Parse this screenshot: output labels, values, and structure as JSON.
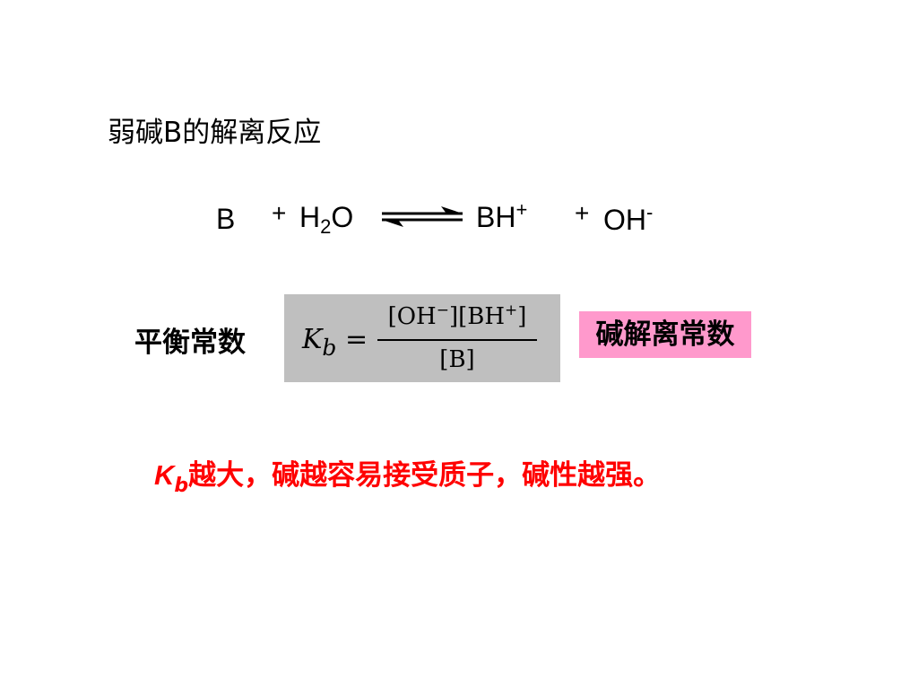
{
  "title": "弱碱B的解离反应",
  "equation": {
    "reactant1": "B",
    "plus1": "+",
    "water_main": "H",
    "water_sub": "2",
    "water_tail": "O",
    "product1_main": "BH",
    "product1_sup": "+",
    "plus2": "+",
    "product2_main": "OH",
    "product2_sup": "-"
  },
  "equilibrium_label": "平衡常数",
  "formula": {
    "lhs_symbol": "K",
    "lhs_subscript": "b",
    "equals": "=",
    "numerator_part1": "[OH",
    "numerator_sup1": "−",
    "numerator_part2": "][BH",
    "numerator_sup2": "+",
    "numerator_part3": "]",
    "denominator": "[B]"
  },
  "constant_badge": "碱解离常数",
  "conclusion": {
    "symbol": "K",
    "subscript": "b",
    "text": "越大，碱越容易接受质子，碱性越强。"
  },
  "colors": {
    "formula_box": "#bfbfbf",
    "badge": "#ff99cc",
    "conclusion": "#ff0000"
  }
}
